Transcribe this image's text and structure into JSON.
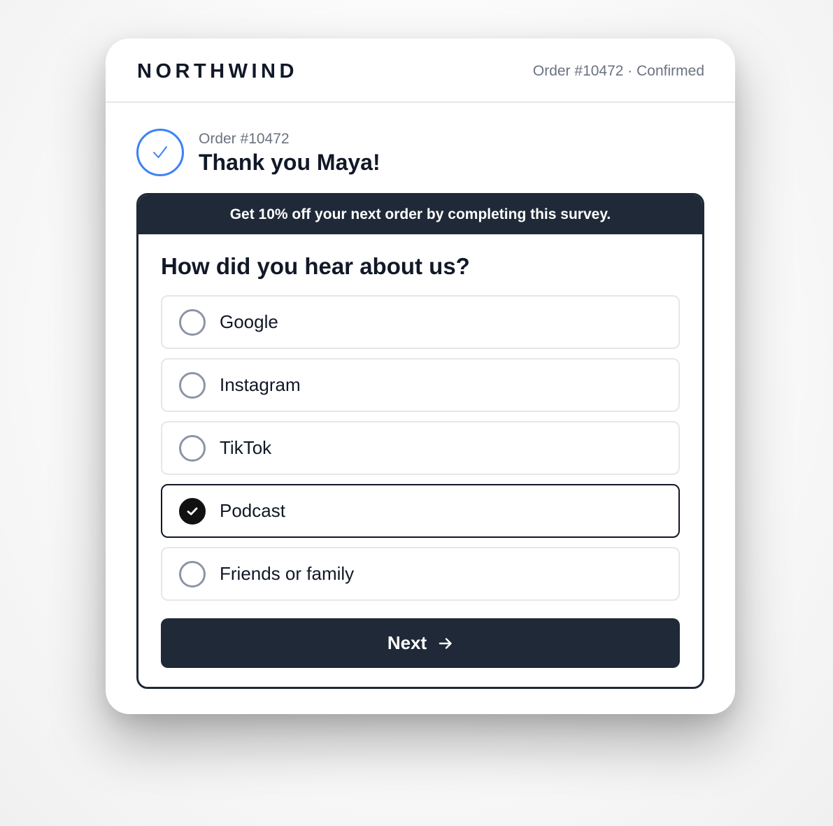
{
  "brand": "NORTHWIND",
  "header": {
    "order_status": "Order #10472 · Confirmed"
  },
  "confirmation": {
    "order_label": "Order #10472",
    "title": "Thank you Maya!"
  },
  "survey": {
    "banner": "Get 10% off your next order by completing this survey.",
    "question": "How did you hear about us?",
    "options": [
      {
        "label": "Google",
        "selected": false
      },
      {
        "label": "Instagram",
        "selected": false
      },
      {
        "label": "TikTok",
        "selected": false
      },
      {
        "label": "Podcast",
        "selected": true
      },
      {
        "label": "Friends or family",
        "selected": false
      }
    ],
    "next_label": "Next"
  },
  "colors": {
    "accent": "#3b82f6",
    "dark": "#1f2937",
    "muted_text": "#6b7280",
    "border": "#e5e7eb"
  },
  "icons": {
    "confirmation": "check-icon",
    "selected_option": "checkmark-icon",
    "next": "arrow-right-icon"
  }
}
